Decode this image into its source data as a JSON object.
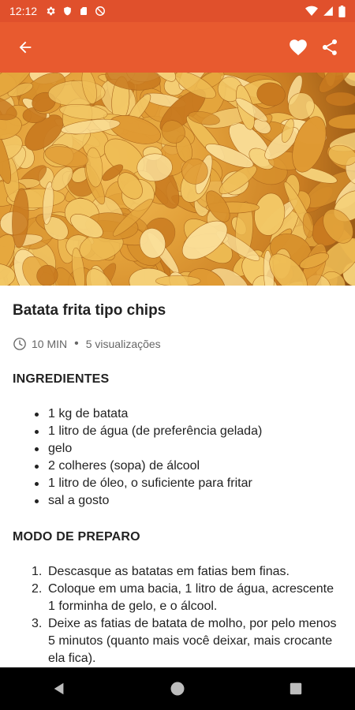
{
  "status_bar": {
    "time": "12:12"
  },
  "recipe": {
    "title": "Batata frita tipo chips",
    "time": "10 MIN",
    "separator": "•",
    "views": "5 visualizações",
    "ingredients_title": "INGREDIENTES",
    "ingredients": [
      "1 kg de batata",
      "1 litro de água (de preferência gelada)",
      "gelo",
      "2 colheres (sopa) de álcool",
      "1 litro de óleo, o suficiente para fritar",
      "sal a gosto"
    ],
    "method_title": "MODO DE PREPARO",
    "steps": [
      {
        "num": "1.",
        "text": "Descasque as batatas em fatias bem finas."
      },
      {
        "num": "2.",
        "text": "Coloque em uma bacia, 1 litro de água, acrescente 1 forminha de gelo, e o álcool."
      },
      {
        "num": "3.",
        "text": "Deixe as fatias de batata de molho, por pelo menos 5 minutos (quanto mais você deixar, mais crocante ela fica)."
      }
    ]
  },
  "icons": {
    "back": "arrow-left-icon",
    "favorite": "heart-icon",
    "share": "share-icon",
    "clock": "clock-icon"
  },
  "colors": {
    "status_bar": "#e0502c",
    "app_bar": "#e85a2f",
    "nav_bar": "#000000"
  }
}
